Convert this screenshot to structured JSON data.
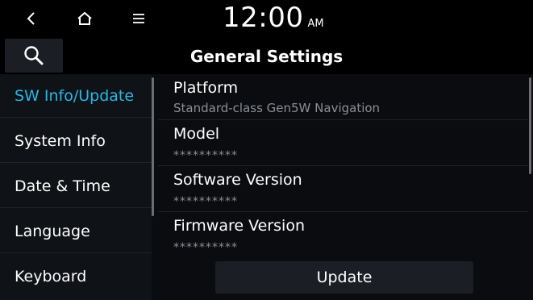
{
  "statusbar": {
    "back_icon": "chevron-left-icon",
    "home_icon": "home-icon",
    "menu_icon": "menu-icon",
    "time": "12:00",
    "ampm": "AM"
  },
  "header": {
    "search_icon": "search-icon",
    "title": "General Settings"
  },
  "sidebar": {
    "items": [
      {
        "label": "SW Info/Update",
        "active": true
      },
      {
        "label": "System Info"
      },
      {
        "label": "Date & Time"
      },
      {
        "label": "Language"
      },
      {
        "label": "Keyboard"
      }
    ]
  },
  "info": {
    "rows": [
      {
        "label": "Platform",
        "value": "Standard-class Gen5W Navigation"
      },
      {
        "label": "Model",
        "value": "**********"
      },
      {
        "label": "Software Version",
        "value": "**********"
      },
      {
        "label": "Firmware Version",
        "value": "**********"
      }
    ],
    "update_label": "Update"
  },
  "colors": {
    "accent": "#29b6e8",
    "background": "#0a0c10",
    "button": "#1b1e24"
  }
}
